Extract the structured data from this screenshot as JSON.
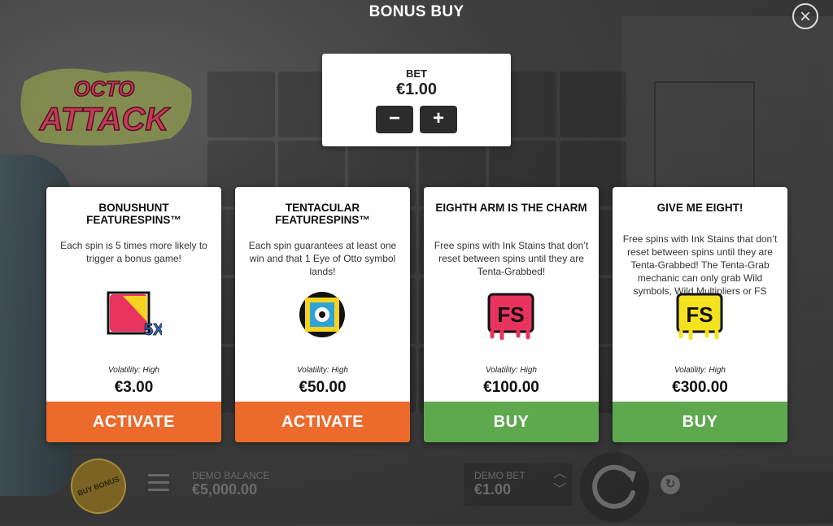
{
  "header": {
    "title": "BONUS BUY",
    "close_icon": "close-icon"
  },
  "logo_text": "OCTO ATTACK",
  "bet": {
    "label": "BET",
    "value": "€1.00",
    "minus_label": "−",
    "plus_label": "+"
  },
  "cards": [
    {
      "title": "BONUSHUNT FEATURESPINS™",
      "description": "Each spin is 5 times more likely to trigger a bonus game!",
      "icon": "bonushunt-5x-icon",
      "icon_text": "5X",
      "volatility": "Volatility: High",
      "price": "€3.00",
      "action": "ACTIVATE",
      "action_color": "#ec6a2c"
    },
    {
      "title": "TENTACULAR FEATURESPINS™",
      "description": "Each spin guarantees at least one win and that 1 Eye of Otto symbol lands!",
      "icon": "eye-of-otto-icon",
      "volatility": "Volatility: High",
      "price": "€50.00",
      "action": "ACTIVATE",
      "action_color": "#ec6a2c"
    },
    {
      "title": "EIGHTH ARM IS THE CHARM",
      "description": "Free spins with Ink Stains that don’t reset between spins until they are Tenta-Grabbed!",
      "icon": "fs-pink-icon",
      "icon_text": "FS",
      "volatility": "Volatility: High",
      "price": "€100.00",
      "action": "BUY",
      "action_color": "#5ea94e"
    },
    {
      "title": "GIVE ME EIGHT!",
      "description": "Free spins with Ink Stains that don’t reset between spins until they are Tenta-Grabbed! The Tenta-Grab mechanic can only grab Wild symbols, Wild Multipliers or FS symbols!",
      "icon": "fs-yellow-icon",
      "icon_text": "FS",
      "volatility": "Volatility: High",
      "price": "€300.00",
      "action": "BUY",
      "action_color": "#5ea94e"
    }
  ],
  "bottom": {
    "buy_bonus": "BUY BONUS",
    "demo_balance_label": "DEMO BALANCE",
    "demo_balance_value": "€5,000.00",
    "demo_bet_label": "DEMO BET",
    "demo_bet_value": "€1.00"
  }
}
